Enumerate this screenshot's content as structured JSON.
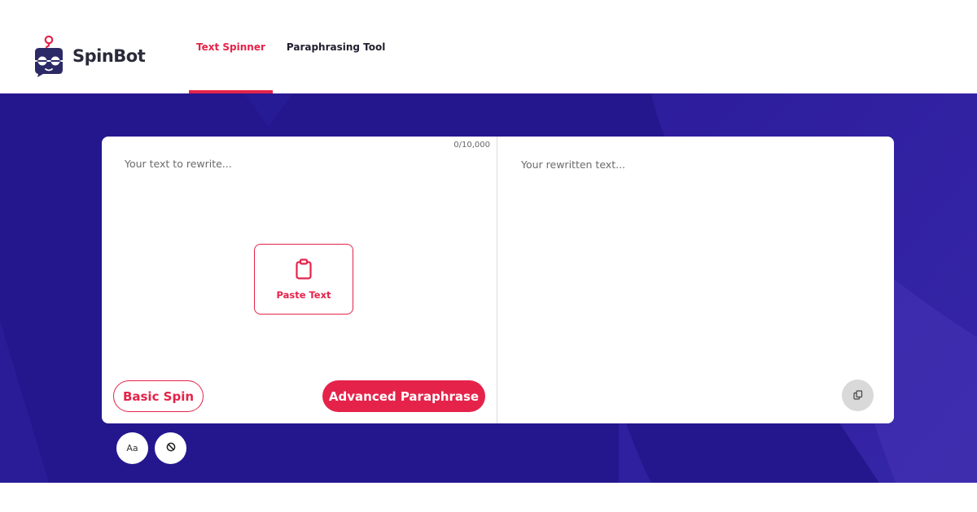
{
  "brand": {
    "name": "SpinBot",
    "primary_color": "#e5234a",
    "hero_color": "#23178f"
  },
  "nav": {
    "items": [
      {
        "label": "Text Spinner",
        "active": true
      },
      {
        "label": "Paraphrasing Tool",
        "active": false
      }
    ]
  },
  "editor": {
    "input_placeholder": "Your text to rewrite...",
    "char_counter": "0/10,000",
    "paste_label": "Paste Text",
    "paste_icon": "clipboard-icon",
    "basic_spin_label": "Basic Spin",
    "advanced_label": "Advanced Paraphrase",
    "output_placeholder": "Your rewritten text...",
    "copy_icon": "copy-icon"
  },
  "tools": {
    "font_label": "Aa",
    "clear_icon": "block-icon"
  }
}
